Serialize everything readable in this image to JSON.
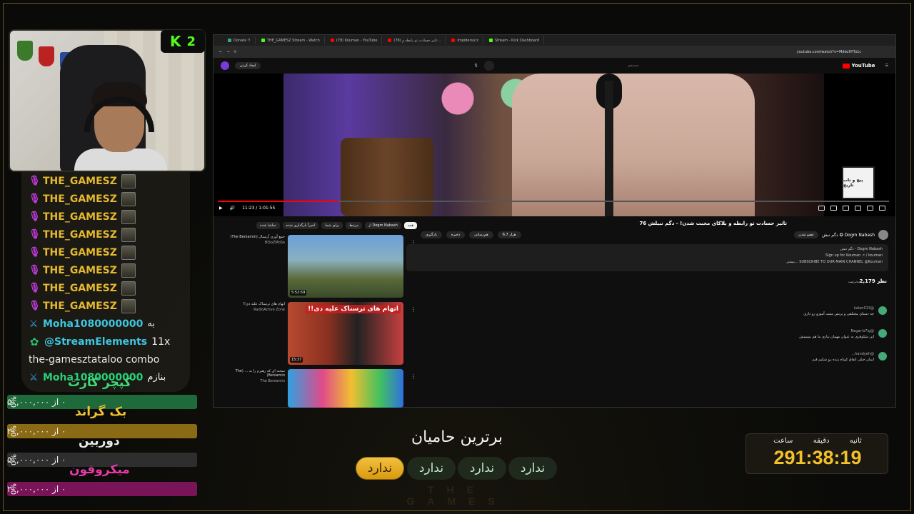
{
  "webcam": {
    "badge_letter": "K",
    "badge_count": "2"
  },
  "chat": {
    "repeat_user": "THE_GAMESZ",
    "lines": [
      {
        "type": "sub",
        "user": "THE_GAMESZ"
      },
      {
        "type": "sub",
        "user": "THE_GAMESZ"
      },
      {
        "type": "sub",
        "user": "THE_GAMESZ"
      },
      {
        "type": "sub",
        "user": "THE_GAMESZ"
      },
      {
        "type": "sub",
        "user": "THE_GAMESZ"
      },
      {
        "type": "sub",
        "user": "THE_GAMESZ"
      },
      {
        "type": "sub",
        "user": "THE_GAMESZ"
      },
      {
        "type": "sub",
        "user": "THE_GAMESZ"
      }
    ],
    "line9": {
      "user": "Moha1080000000",
      "msg": "به"
    },
    "line10": {
      "user": "@StreamElements",
      "msg": "11x"
    },
    "line11": {
      "text": "the-gamesztataloo combo"
    },
    "line12": {
      "user": "Moha1080000000",
      "msg": "بنازم"
    }
  },
  "goals": [
    {
      "title": "کپچر کارت",
      "progress": "۰ از ۵۰,۰۰۰,۰۰۰",
      "pct": "0%",
      "color": "#1f6a3a",
      "title_color": "#3edb78"
    },
    {
      "title": "بک گراند",
      "progress": "۰ از ۲۰,۰۰۰,۰۰۰",
      "pct": "0%",
      "color": "#8a6a14",
      "title_color": "#f1c232"
    },
    {
      "title": "دوربین",
      "progress": "۰ از ۵۰,۰۰۰,۰۰۰",
      "pct": "0%",
      "color": "#2e2e2e",
      "title_color": "#e8e8e8"
    },
    {
      "title": "میکروفون",
      "progress": "۰ از ۲۰,۰۰۰,۰۰۰",
      "pct": "0%",
      "color": "#7a1458",
      "title_color": "#e83aa8"
    }
  ],
  "browser": {
    "tabs": [
      {
        "label": "Donate !!",
        "color": "#3a8"
      },
      {
        "label": "THE_GAMESZ Stream - Watch",
        "color": "#53fc18"
      },
      {
        "label": "(78) Kouman - YouTube",
        "color": "#f00"
      },
      {
        "label": "(78) تاثیر حسادت تو رابطه و...",
        "color": "#f00"
      },
      {
        "label": "Impidersu!z",
        "color": "#f00"
      },
      {
        "label": "Stream - Kick Dashboard",
        "color": "#53fc18"
      }
    ],
    "url": "youtube.com/watch?v=Mdko9YTu1c",
    "yt_logo": "YouTube",
    "search_placeholder": "جستجو",
    "create_label": "ایجاد کردن"
  },
  "player": {
    "time": "11:23 / 1:01:55",
    "progress_fraction": 0.18,
    "watermark": "پیچ و تاب تاریخ"
  },
  "video": {
    "title": "تاثیر حسادت تو رابطه و بلاکای محبت شدن! - دگم نبیلش 76",
    "channel": "Dogm Nabash ✪ دگم نبش",
    "subscribers": "56.8K",
    "subscribe": "عضو شدن",
    "like": "6.7 هزار",
    "share": "هم‌رسانی",
    "download": "بارگیری",
    "save": "ذخیره"
  },
  "description": {
    "line1": "Dogm Nabash - دگم نبش",
    "line2": "Sign up for Kouman ↗ / kouman",
    "line3": "SUBSCRIBE TO OUR MAIN CHANNEL @Kouman ...بیشتر"
  },
  "comments": {
    "count": "2,179 نظر",
    "sort": "به‌ترتیب",
    "items": [
      {
        "user": "@kalan013",
        "text": "چه دستای مختلفی و پرنس مثبت آموزو رو داری"
      },
      {
        "user": "@Negar-b7ig",
        "text": "این شکوفری به عنوان مهمان بیاری ما هم ببینیمش"
      },
      {
        "user": "@handyeh...",
        "text": "ایمان خیلی اتفاق کوتاه زنده رو شکیم قیم"
      }
    ]
  },
  "chips": [
    "همه",
    "Dogm Nabash از",
    "مرتبط",
    "برای شما",
    "اخیراً بارگذاری شده",
    "تماشا شده"
  ],
  "recommendations": [
    {
      "title": "جمع آوری آرسنال (The Beniamin)",
      "channel": "BiSoZMoSo",
      "duration": "5:52:59"
    },
    {
      "title": "اتهام های ترسناک علیه دی!!",
      "channel": "RadioActive Zone",
      "duration": "15:37",
      "overlay": "اتهام های ترسناک علیه دی!!"
    },
    {
      "title": "سخنه ای که رهبرم را به ... (The Beniamin)",
      "channel": "The Beniamin",
      "duration": ""
    }
  ],
  "supporters": {
    "title": "برترین حامیان",
    "slots": [
      "ندارد",
      "ندارد",
      "ندارد",
      "ندارد"
    ],
    "ghost": "THE GAMES"
  },
  "timer": {
    "labels": [
      "ساعت",
      "دقیقه",
      "ثانیه"
    ],
    "value": "291:38:19"
  }
}
